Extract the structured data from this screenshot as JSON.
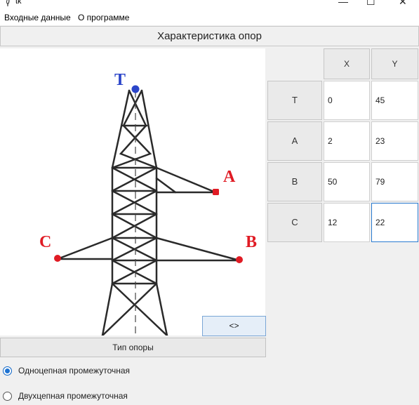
{
  "window": {
    "title": "tk",
    "minimize": "—",
    "maximize": "☐",
    "close": "✕"
  },
  "menu": {
    "items": [
      "Входные данные",
      "О программе"
    ]
  },
  "header": {
    "title": "Характеристика опор"
  },
  "table": {
    "columns": [
      "X",
      "Y"
    ],
    "rows": [
      {
        "label": "T",
        "x": "0",
        "y": "45"
      },
      {
        "label": "A",
        "x": "2",
        "y": "23"
      },
      {
        "label": "B",
        "x": "50",
        "y": "79"
      },
      {
        "label": "C",
        "x": "12",
        "y": "22"
      }
    ]
  },
  "tower": {
    "labels": {
      "t": "T",
      "a": "A",
      "b": "B",
      "c": "C"
    },
    "point_colors": {
      "top": "#2b45c9",
      "phase": "#e01b24"
    }
  },
  "swap_button": {
    "label": "<>"
  },
  "type_button": {
    "label": "Тип опоры"
  },
  "radios": [
    {
      "label": "Одноцепная промежуточная",
      "checked": true
    },
    {
      "label": "Двухцепная промежуточная",
      "checked": false
    }
  ]
}
